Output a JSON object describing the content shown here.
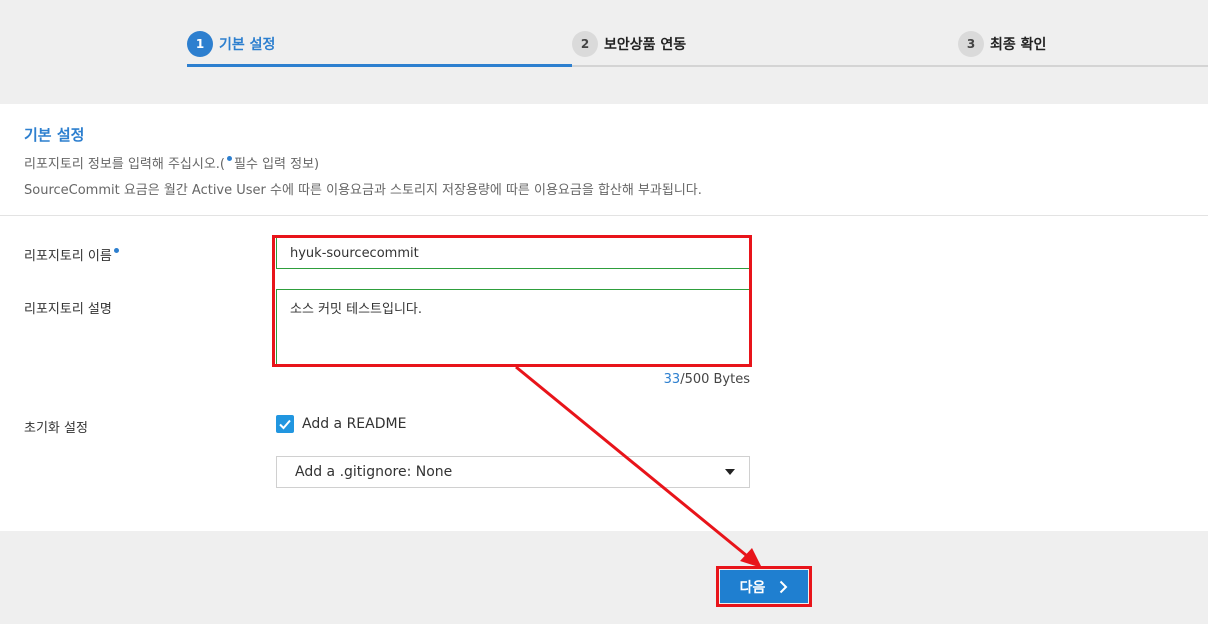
{
  "stepper": {
    "steps": [
      {
        "num": "1",
        "label": "기본 설정"
      },
      {
        "num": "2",
        "label": "보안상품 연동"
      },
      {
        "num": "3",
        "label": "최종 확인"
      }
    ]
  },
  "section": {
    "title": "기본 설정",
    "desc_prefix": "리포지토리 정보를 입력해 주십시오.(",
    "desc_suffix": "필수 입력 정보)",
    "desc_billing": "SourceCommit 요금은 월간 Active User 수에 따른 이용요금과 스토리지 저장용량에 따른 이용요금을 합산해 부과됩니다."
  },
  "form": {
    "name_label": "리포지토리 이름",
    "name_value": "hyuk-sourcecommit",
    "desc_label": "리포지토리 설명",
    "desc_value": "소스 커밋 테스트입니다.",
    "byte_used": "33",
    "byte_limit": "/500 Bytes",
    "init_label": "초기화 설정",
    "readme_label": "Add a README",
    "gitignore_value": "Add a .gitignore: None"
  },
  "actions": {
    "next_label": "다음"
  },
  "colors": {
    "accent": "#2d7fcf",
    "highlight": "#e8141a",
    "valid_border": "#2e9e3c"
  },
  "icons": {
    "required": "required-dot-icon",
    "checkbox": "checkmark-icon",
    "dropdown": "caret-down-icon",
    "next": "chevron-right-icon"
  }
}
